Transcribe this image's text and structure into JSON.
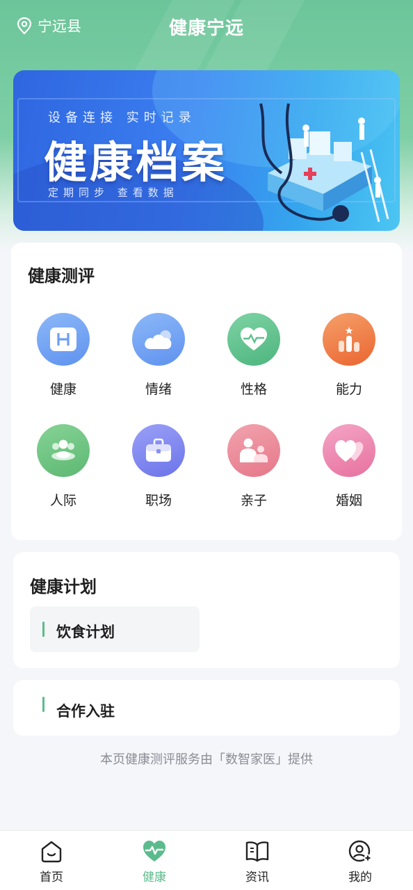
{
  "header": {
    "location": "宁远县",
    "title": "健康宁远"
  },
  "banner": {
    "subtitle_top": "设备连接  实时记录",
    "headline": "健康档案",
    "subtitle_bottom": "定期同步    查看数据"
  },
  "evaluation": {
    "title": "健康测评",
    "items": [
      {
        "label": "健康",
        "icon": "hospital-h-icon",
        "color": "#6fa2f4"
      },
      {
        "label": "情绪",
        "icon": "cloud-icon",
        "color": "#6fa2f4"
      },
      {
        "label": "性格",
        "icon": "heart-pulse-icon",
        "color": "#5fc08c"
      },
      {
        "label": "能力",
        "icon": "bar-chart-star-icon",
        "color": "#f27b45"
      },
      {
        "label": "人际",
        "icon": "group-people-icon",
        "color": "#6cc47f"
      },
      {
        "label": "职场",
        "icon": "briefcase-icon",
        "color": "#7f86f0"
      },
      {
        "label": "亲子",
        "icon": "parent-child-icon",
        "color": "#ec8a9a"
      },
      {
        "label": "婚姻",
        "icon": "double-heart-icon",
        "color": "#ef89b4"
      }
    ]
  },
  "plan": {
    "title": "健康计划",
    "items": [
      {
        "label": "饮食计划"
      }
    ]
  },
  "cooperation": {
    "label": "合作入驻"
  },
  "footer_note": "本页健康测评服务由「数智家医」提供",
  "tabbar": {
    "items": [
      {
        "label": "首页",
        "icon": "home-smile-icon"
      },
      {
        "label": "健康",
        "icon": "heart-pulse-icon",
        "active": true
      },
      {
        "label": "资讯",
        "icon": "open-book-icon"
      },
      {
        "label": "我的",
        "icon": "user-plus-icon"
      }
    ]
  },
  "colors": {
    "accent": "#5bbb8c",
    "header_green": "#6cc59a"
  }
}
